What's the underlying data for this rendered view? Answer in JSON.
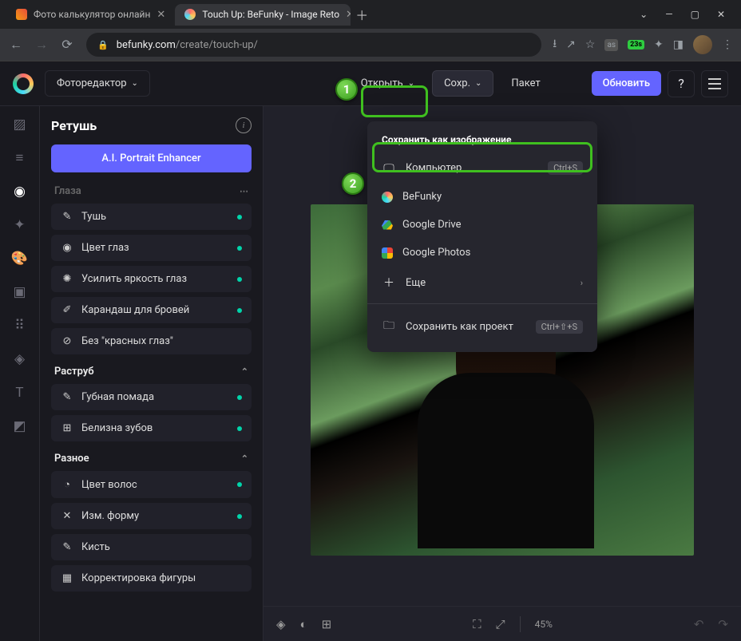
{
  "browser": {
    "tabs": [
      {
        "title": "Фото калькулятор онлайн",
        "active": false
      },
      {
        "title": "Touch Up: BeFunky - Image Reto",
        "active": true
      }
    ],
    "url_domain": "befunky.com",
    "url_path": "/create/touch-up/",
    "ext_badge": "23s"
  },
  "appbar": {
    "mode": "Фоторедактор",
    "open": "Открыть",
    "save": "Сохр.",
    "batch": "Пакет",
    "upgrade": "Обновить"
  },
  "panel": {
    "title": "Ретушь",
    "ai_button": "A.I. Portrait Enhancer",
    "section_eyes_trunc": "Глаза",
    "tools_eyes": [
      {
        "label": "Тушь",
        "icon": "✎",
        "dot": true
      },
      {
        "label": "Цвет глаз",
        "icon": "◉",
        "dot": true
      },
      {
        "label": "Усилить яркость глаз",
        "icon": "✺",
        "dot": true
      },
      {
        "label": "Карандаш для бровей",
        "icon": "✐",
        "dot": true
      },
      {
        "label": "Без \"красных глаз\"",
        "icon": "⊘",
        "dot": false
      }
    ],
    "section_mouth": "Раструб",
    "tools_mouth": [
      {
        "label": "Губная помада",
        "icon": "✎",
        "dot": true
      },
      {
        "label": "Белизна зубов",
        "icon": "⊞",
        "dot": true
      }
    ],
    "section_misc": "Разное",
    "tools_misc": [
      {
        "label": "Цвет волос",
        "icon": "◔",
        "dot": true
      },
      {
        "label": "Изм. форму",
        "icon": "✕",
        "dot": true
      },
      {
        "label": "Кисть",
        "icon": "✎",
        "dot": false
      },
      {
        "label": "Корректировка фигуры",
        "icon": "▦",
        "dot": false
      }
    ]
  },
  "dropdown": {
    "header": "Сохранить как изображение",
    "items": [
      {
        "label": "Компьютер",
        "icon": "🖵",
        "shortcut": "Ctrl+S",
        "highlighted": true
      },
      {
        "label": "BeFunky",
        "icon": "befunky"
      },
      {
        "label": "Google Drive",
        "icon": "gdrive"
      },
      {
        "label": "Google Photos",
        "icon": "gphotos"
      },
      {
        "label": "Еще",
        "icon": "＋",
        "chevron": true
      }
    ],
    "project": {
      "label": "Сохранить как проект",
      "icon": "🗀",
      "shortcut": "Ctrl+⇧+S"
    }
  },
  "canvas": {
    "zoom": "45%"
  },
  "callouts": {
    "one": "1",
    "two": "2"
  }
}
